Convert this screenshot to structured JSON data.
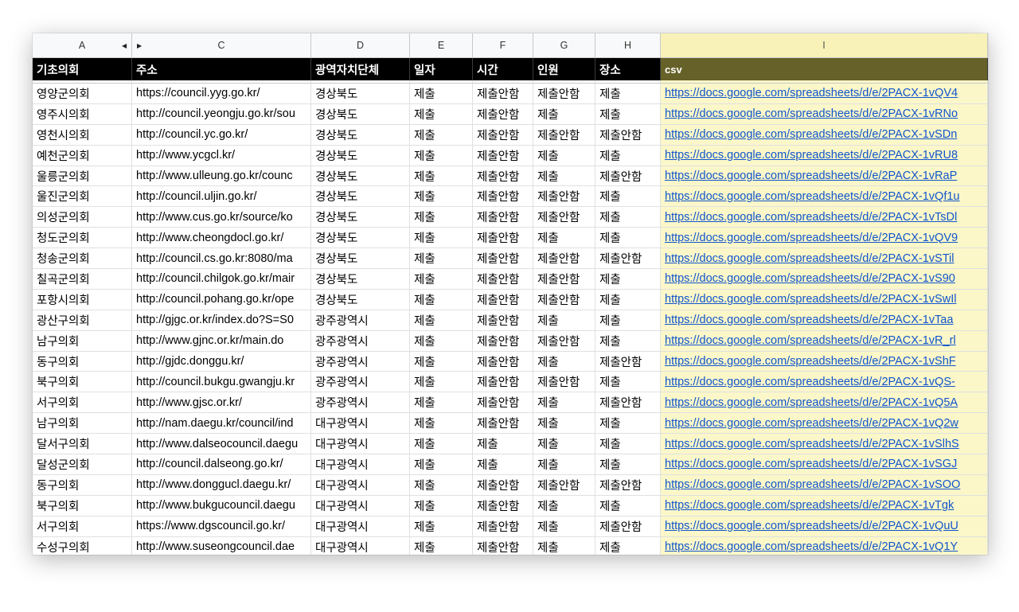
{
  "column_letters": [
    "A",
    "C",
    "D",
    "E",
    "F",
    "G",
    "H",
    "I"
  ],
  "headers": {
    "council": "기초의회",
    "address": "주소",
    "province": "광역자치단체",
    "date": "일자",
    "time": "시간",
    "people": "인원",
    "place": "장소",
    "csv": "csv"
  },
  "rows": [
    {
      "council": "영양군의회",
      "address": "https://council.yyg.go.kr/",
      "province": "경상북도",
      "date": "제출",
      "time": "제출안함",
      "people": "제출안함",
      "place": "제출",
      "csv": "https://docs.google.com/spreadsheets/d/e/2PACX-1vQV4"
    },
    {
      "council": "영주시의회",
      "address": "http://council.yeongju.go.kr/sou",
      "province": "경상북도",
      "date": "제출",
      "time": "제출안함",
      "people": "제출",
      "place": "제출",
      "csv": "https://docs.google.com/spreadsheets/d/e/2PACX-1vRNo"
    },
    {
      "council": "영천시의회",
      "address": "http://council.yc.go.kr/",
      "province": "경상북도",
      "date": "제출",
      "time": "제출안함",
      "people": "제출안함",
      "place": "제출안함",
      "csv": "https://docs.google.com/spreadsheets/d/e/2PACX-1vSDn"
    },
    {
      "council": "예천군의회",
      "address": "http://www.ycgcl.kr/",
      "province": "경상북도",
      "date": "제출",
      "time": "제출안함",
      "people": "제출",
      "place": "제출",
      "csv": "https://docs.google.com/spreadsheets/d/e/2PACX-1vRU8"
    },
    {
      "council": "울릉군의회",
      "address": "http://www.ulleung.go.kr/counc",
      "province": "경상북도",
      "date": "제출",
      "time": "제출안함",
      "people": "제출",
      "place": "제출안함",
      "csv": "https://docs.google.com/spreadsheets/d/e/2PACX-1vRaP"
    },
    {
      "council": "울진군의회",
      "address": "http://council.uljin.go.kr/",
      "province": "경상북도",
      "date": "제출",
      "time": "제출안함",
      "people": "제출안함",
      "place": "제출",
      "csv": "https://docs.google.com/spreadsheets/d/e/2PACX-1vQf1u"
    },
    {
      "council": "의성군의회",
      "address": "http://www.cus.go.kr/source/ko",
      "province": "경상북도",
      "date": "제출",
      "time": "제출안함",
      "people": "제출안함",
      "place": "제출",
      "csv": "https://docs.google.com/spreadsheets/d/e/2PACX-1vTsDl"
    },
    {
      "council": "청도군의회",
      "address": "http://www.cheongdocl.go.kr/",
      "province": "경상북도",
      "date": "제출",
      "time": "제출안함",
      "people": "제출",
      "place": "제출",
      "csv": "https://docs.google.com/spreadsheets/d/e/2PACX-1vQV9"
    },
    {
      "council": "청송군의회",
      "address": "http://council.cs.go.kr:8080/ma",
      "province": "경상북도",
      "date": "제출",
      "time": "제출안함",
      "people": "제출안함",
      "place": "제출안함",
      "csv": "https://docs.google.com/spreadsheets/d/e/2PACX-1vSTil"
    },
    {
      "council": "칠곡군의회",
      "address": "http://council.chilgok.go.kr/mair",
      "province": "경상북도",
      "date": "제출",
      "time": "제출안함",
      "people": "제출안함",
      "place": "제출",
      "csv": "https://docs.google.com/spreadsheets/d/e/2PACX-1vS90"
    },
    {
      "council": "포항시의회",
      "address": "http://council.pohang.go.kr/ope",
      "province": "경상북도",
      "date": "제출",
      "time": "제출안함",
      "people": "제출안함",
      "place": "제출",
      "csv": "https://docs.google.com/spreadsheets/d/e/2PACX-1vSwIl"
    },
    {
      "council": "광산구의회",
      "address": "http://gjgc.or.kr/index.do?S=S0",
      "province": "광주광역시",
      "date": "제출",
      "time": "제출안함",
      "people": "제출",
      "place": "제출",
      "csv": "https://docs.google.com/spreadsheets/d/e/2PACX-1vTaa"
    },
    {
      "council": "남구의회",
      "address": "http://www.gjnc.or.kr/main.do",
      "province": "광주광역시",
      "date": "제출",
      "time": "제출안함",
      "people": "제출안함",
      "place": "제출",
      "csv": "https://docs.google.com/spreadsheets/d/e/2PACX-1vR_rl"
    },
    {
      "council": "동구의회",
      "address": "http://gjdc.donggu.kr/",
      "province": "광주광역시",
      "date": "제출",
      "time": "제출안함",
      "people": "제출",
      "place": "제출안함",
      "csv": "https://docs.google.com/spreadsheets/d/e/2PACX-1vShF"
    },
    {
      "council": "북구의회",
      "address": "http://council.bukgu.gwangju.kr",
      "province": "광주광역시",
      "date": "제출",
      "time": "제출안함",
      "people": "제출안함",
      "place": "제출",
      "csv": "https://docs.google.com/spreadsheets/d/e/2PACX-1vQS-"
    },
    {
      "council": "서구의회",
      "address": "http://www.gjsc.or.kr/",
      "province": "광주광역시",
      "date": "제출",
      "time": "제출안함",
      "people": "제출",
      "place": "제출안함",
      "csv": "https://docs.google.com/spreadsheets/d/e/2PACX-1vQ5A"
    },
    {
      "council": "남구의회",
      "address": "http://nam.daegu.kr/council/ind",
      "province": "대구광역시",
      "date": "제출",
      "time": "제출안함",
      "people": "제출",
      "place": "제출",
      "csv": "https://docs.google.com/spreadsheets/d/e/2PACX-1vQ2w"
    },
    {
      "council": "달서구의회",
      "address": "http://www.dalseocouncil.daegu",
      "province": "대구광역시",
      "date": "제출",
      "time": "제출",
      "people": "제출",
      "place": "제출",
      "csv": "https://docs.google.com/spreadsheets/d/e/2PACX-1vSlhS"
    },
    {
      "council": "달성군의회",
      "address": "http://council.dalseong.go.kr/",
      "province": "대구광역시",
      "date": "제출",
      "time": "제출",
      "people": "제출",
      "place": "제출",
      "csv": "https://docs.google.com/spreadsheets/d/e/2PACX-1vSGJ"
    },
    {
      "council": "동구의회",
      "address": "http://www.donggucl.daegu.kr/",
      "province": "대구광역시",
      "date": "제출",
      "time": "제출안함",
      "people": "제출안함",
      "place": "제출안함",
      "csv": "https://docs.google.com/spreadsheets/d/e/2PACX-1vSOO"
    },
    {
      "council": "북구의회",
      "address": "http://www.bukgucouncil.daegu",
      "province": "대구광역시",
      "date": "제출",
      "time": "제출안함",
      "people": "제출",
      "place": "제출",
      "csv": "https://docs.google.com/spreadsheets/d/e/2PACX-1vTgk"
    },
    {
      "council": "서구의회",
      "address": "https://www.dgscouncil.go.kr/",
      "province": "대구광역시",
      "date": "제출",
      "time": "제출안함",
      "people": "제출",
      "place": "제출안함",
      "csv": "https://docs.google.com/spreadsheets/d/e/2PACX-1vQuU"
    },
    {
      "council": "수성구의회",
      "address": "http://www.suseongcouncil.dae",
      "province": "대구광역시",
      "date": "제출",
      "time": "제출안함",
      "people": "제출",
      "place": "제출",
      "csv": "https://docs.google.com/spreadsheets/d/e/2PACX-1vQ1Y"
    }
  ],
  "colors": {
    "header_bg": "#000000",
    "csv_header_bg": "#666128",
    "selected_column_bg": "#fbf7c9",
    "link": "#1155cc"
  }
}
